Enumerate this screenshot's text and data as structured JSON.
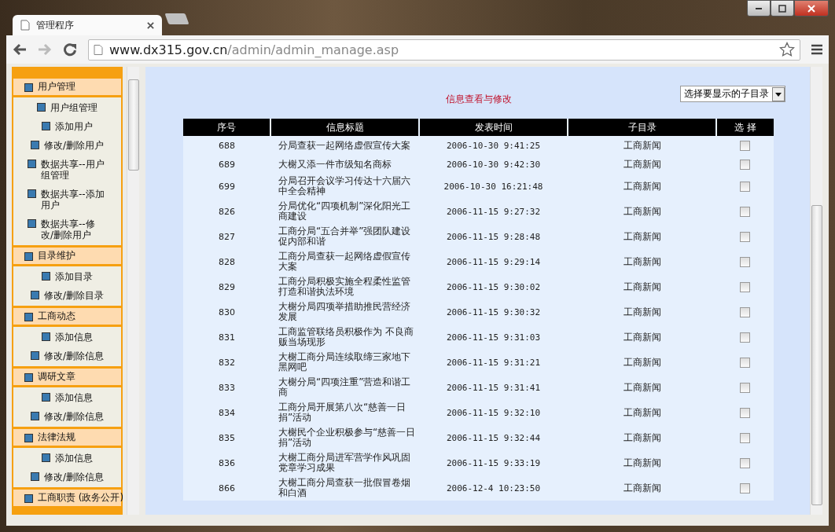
{
  "browser": {
    "tab_title": "管理程序",
    "url_host": "www.dx315.gov.cn",
    "url_path": "/admin/admin_manage.asp"
  },
  "sidebar": {
    "sections": [
      {
        "title": "用户管理",
        "items": [
          "用户组管理",
          "添加用户",
          "修改/删除用户",
          "数据共享--用户组管理",
          "数据共享--添加用户",
          "数据共享--修改/删除用户"
        ]
      },
      {
        "title": "目录维护",
        "items": [
          "添加目录",
          "修改/删除目录"
        ]
      },
      {
        "title": "工商动态",
        "items": [
          "添加信息",
          "修改/删除信息"
        ]
      },
      {
        "title": "调研文章",
        "items": [
          "添加信息",
          "修改/删除信息"
        ]
      },
      {
        "title": "法律法规",
        "items": [
          "添加信息",
          "修改/删除信息"
        ]
      },
      {
        "title": "工商职责 (政务公开)"
      }
    ]
  },
  "main": {
    "heading": "信息查看与修改",
    "dropdown": "选择要显示的子目录",
    "table": {
      "columns": [
        "序号",
        "信息标题",
        "发表时间",
        "子目录",
        "选 择"
      ],
      "rows": [
        {
          "id": "688",
          "title": "分局查获一起网络虚假宣传大案",
          "time": "2006-10-30 9:41:25",
          "category": "工商新闻",
          "checked": false
        },
        {
          "id": "689",
          "title": "大榭又添一件市级知名商标",
          "time": "2006-10-30 9:42:30",
          "category": "工商新闻",
          "checked": false
        },
        {
          "id": "699",
          "title": "分局召开会议学习传达十六届六中全会精神",
          "time": "2006-10-30 16:21:48",
          "category": "工商新闻",
          "checked": false
        },
        {
          "id": "826",
          "title": "分局优化“四项机制”深化阳光工商建设",
          "time": "2006-11-15 9:27:32",
          "category": "工商新闻",
          "checked": false
        },
        {
          "id": "827",
          "title": "工商分局“五合并举”强团队建设促内部和谐",
          "time": "2006-11-15 9:28:48",
          "category": "工商新闻",
          "checked": false
        },
        {
          "id": "828",
          "title": "工商分局查获一起网络虚假宣传大案",
          "time": "2006-11-15 9:29:14",
          "category": "工商新闻",
          "checked": false
        },
        {
          "id": "829",
          "title": "工商分局积极实施全程柔性监管打造和谐执法环境",
          "time": "2006-11-15 9:30:02",
          "category": "工商新闻",
          "checked": false
        },
        {
          "id": "830",
          "title": "大榭分局四项举措助推民营经济发展",
          "time": "2006-11-15 9:30:32",
          "category": "工商新闻",
          "checked": false
        },
        {
          "id": "831",
          "title": "工商监管联络员积极作为 不良商贩当场现形",
          "time": "2006-11-15 9:31:03",
          "category": "工商新闻",
          "checked": false
        },
        {
          "id": "832",
          "title": "大榭工商分局连续取缔三家地下黑网吧",
          "time": "2006-11-15 9:31:21",
          "category": "工商新闻",
          "checked": false
        },
        {
          "id": "833",
          "title": "大榭分局“四项注重”营造和谐工商",
          "time": "2006-11-15 9:31:41",
          "category": "工商新闻",
          "checked": false
        },
        {
          "id": "834",
          "title": "工商分局开展第八次“慈善一日捐”活动",
          "time": "2006-11-15 9:32:10",
          "category": "工商新闻",
          "checked": false
        },
        {
          "id": "835",
          "title": "大榭民个企业积极参与“慈善一日捐”活动",
          "time": "2006-11-15 9:32:44",
          "category": "工商新闻",
          "checked": false
        },
        {
          "id": "836",
          "title": "大榭工商分局进军营学作风巩固党章学习成果",
          "time": "2006-11-15 9:33:19",
          "category": "工商新闻",
          "checked": false
        },
        {
          "id": "866",
          "title": "大榭工商分局查获一批假冒卷烟和白酒",
          "time": "2006-12-4 10:23:50",
          "category": "工商新闻",
          "checked": false
        }
      ]
    }
  }
}
